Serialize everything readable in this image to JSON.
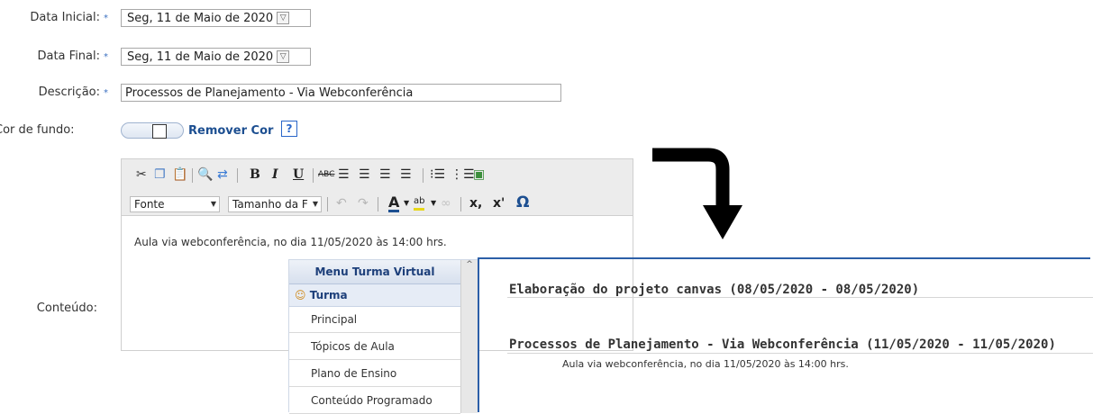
{
  "form": {
    "data_inicial_label": "Data Inicial:",
    "data_inicial_value": "Seg, 11 de Maio de 2020",
    "data_final_label": "Data Final:",
    "data_final_value": "Seg, 11 de Maio de 2020",
    "descricao_label": "Descrição:",
    "descricao_value": "Processos de Planejamento - Via Webconferência",
    "cor_label": "Cor de fundo:",
    "remover_cor": "Remover Cor",
    "help": "?",
    "conteudo_label": "Conteúdo:",
    "required_mark": "*"
  },
  "editor": {
    "font_select": "Fonte",
    "size_select": "Tamanho da F",
    "content": "Aula via webconferência, no dia 11/05/2020 às 14:00 hrs.",
    "bold": "B",
    "italic": "I",
    "underline": "U",
    "subscript": "x,",
    "superscript": "x'",
    "omega": "Ω",
    "font_color": "A"
  },
  "menu": {
    "title": "Menu Turma Virtual",
    "section": "Turma",
    "items": [
      "Principal",
      "Tópicos de Aula",
      "Plano de Ensino",
      "Conteúdo Programado"
    ]
  },
  "topics": [
    {
      "title": "Elaboração do projeto canvas (08/05/2020 - 08/05/2020)"
    },
    {
      "title": "Processos de Planejamento - Via Webconferência (11/05/2020 - 11/05/2020)",
      "description": "Aula via webconferência, no dia 11/05/2020 às 14:00 hrs."
    }
  ],
  "icons": [
    "cut-icon",
    "copy-icon",
    "paste-icon",
    "find-icon",
    "replace-icon",
    "spellcheck-icon",
    "align-left-icon",
    "align-center-icon",
    "align-right-icon",
    "justify-icon",
    "bullet-list-icon",
    "numbered-list-icon",
    "image-icon",
    "undo-icon",
    "redo-icon",
    "highlight-icon",
    "link-icon",
    "arrow-icon"
  ],
  "colors": {
    "accent": "#2c5fa8",
    "required_star": "#3a6fc0",
    "link": "#1d4f91"
  }
}
